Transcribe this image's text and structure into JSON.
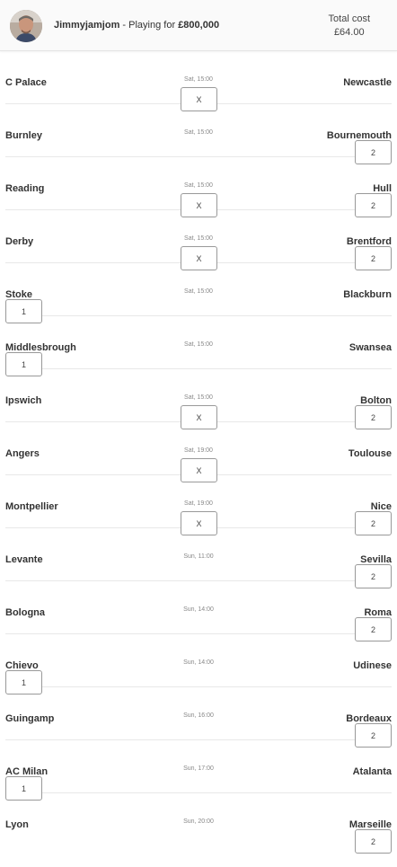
{
  "header": {
    "player_name": "Jimmyjamjom",
    "playing_for_prefix": " - Playing for ",
    "playing_for_amount": "£800,000",
    "total_cost_label": "Total cost",
    "total_cost_value": "£64.00",
    "avatar": "user-avatar-photo"
  },
  "matches": [
    {
      "home": "C Palace",
      "away": "Newcastle",
      "time": "Sat, 15:00",
      "pick": "X"
    },
    {
      "home": "Burnley",
      "away": "Bournemouth",
      "time": "Sat, 15:00",
      "pick": "2"
    },
    {
      "home": "Reading",
      "away": "Hull",
      "time": "Sat, 15:00",
      "pick": "X2"
    },
    {
      "home": "Derby",
      "away": "Brentford",
      "time": "Sat, 15:00",
      "pick": "X2"
    },
    {
      "home": "Stoke",
      "away": "Blackburn",
      "time": "Sat, 15:00",
      "pick": "1"
    },
    {
      "home": "Middlesbrough",
      "away": "Swansea",
      "time": "Sat, 15:00",
      "pick": "1"
    },
    {
      "home": "Ipswich",
      "away": "Bolton",
      "time": "Sat, 15:00",
      "pick": "X2"
    },
    {
      "home": "Angers",
      "away": "Toulouse",
      "time": "Sat, 19:00",
      "pick": "X"
    },
    {
      "home": "Montpellier",
      "away": "Nice",
      "time": "Sat, 19:00",
      "pick": "X2"
    },
    {
      "home": "Levante",
      "away": "Sevilla",
      "time": "Sun, 11:00",
      "pick": "2"
    },
    {
      "home": "Bologna",
      "away": "Roma",
      "time": "Sun, 14:00",
      "pick": "2"
    },
    {
      "home": "Chievo",
      "away": "Udinese",
      "time": "Sun, 14:00",
      "pick": "1"
    },
    {
      "home": "Guingamp",
      "away": "Bordeaux",
      "time": "Sun, 16:00",
      "pick": "2"
    },
    {
      "home": "AC Milan",
      "away": "Atalanta",
      "time": "Sun, 17:00",
      "pick": "1"
    },
    {
      "home": "Lyon",
      "away": "Marseille",
      "time": "Sun, 20:00",
      "pick": "2"
    }
  ],
  "pick_labels": {
    "one": "1",
    "draw": "X",
    "two": "2"
  }
}
